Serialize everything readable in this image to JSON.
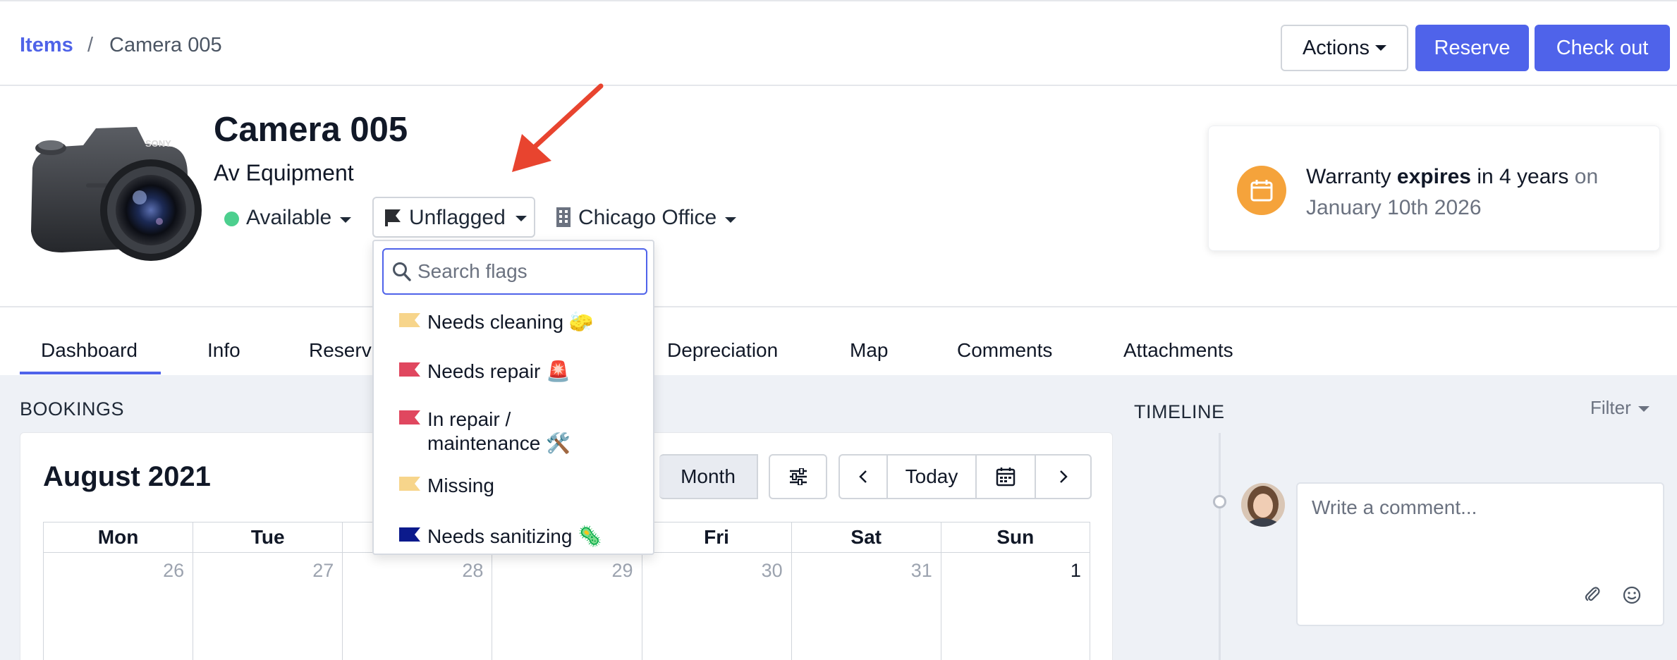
{
  "breadcrumb": {
    "root": "Items",
    "separator": "/",
    "current": "Camera 005"
  },
  "toolbar": {
    "actions_label": "Actions",
    "reserve_label": "Reserve",
    "checkout_label": "Check out"
  },
  "item": {
    "title": "Camera 005",
    "category": "Av Equipment",
    "status": "Available",
    "flag": "Unflagged",
    "location": "Chicago Office"
  },
  "warranty": {
    "prefix": "Warranty",
    "bold": "expires",
    "middle": "in 4 years",
    "suffix_muted": "on January 10th 2026"
  },
  "tabs": [
    {
      "label": "Dashboard",
      "active": true
    },
    {
      "label": "Info"
    },
    {
      "label": "Reserv"
    },
    {
      "label": "Depreciation"
    },
    {
      "label": "Map"
    },
    {
      "label": "Comments"
    },
    {
      "label": "Attachments"
    }
  ],
  "bookings": {
    "section_label": "BOOKINGS",
    "month_title": "August 2021",
    "view_button": "Month",
    "today_button": "Today",
    "weekdays": [
      "Mon",
      "Tue",
      "",
      "",
      "Fri",
      "Sat",
      "Sun"
    ],
    "days": [
      "26",
      "27",
      "28",
      "29",
      "30",
      "31",
      "1"
    ]
  },
  "timeline": {
    "section_label": "TIMELINE",
    "filter_label": "Filter",
    "comment_placeholder": "Write a comment..."
  },
  "flag_dropdown": {
    "search_placeholder": "Search flags",
    "options": [
      {
        "label": "Needs cleaning 🧽",
        "color": "#f7d58b"
      },
      {
        "label": "Needs repair 🚨",
        "color": "#e0475f"
      },
      {
        "label": "In repair / maintenance 🛠️",
        "color": "#e0475f"
      },
      {
        "label": "Missing",
        "color": "#f7d58b"
      },
      {
        "label": "Needs sanitizing 🦠",
        "color": "#0b1a8c"
      }
    ]
  },
  "colors": {
    "primary": "#4f63ea",
    "status_available": "#4ccf8e",
    "warranty_icon": "#f5a33b",
    "annotation_arrow": "#e8442f"
  }
}
